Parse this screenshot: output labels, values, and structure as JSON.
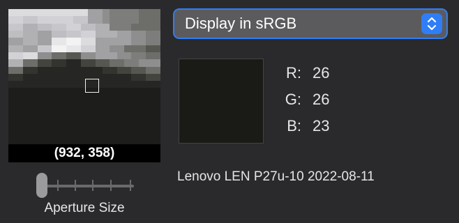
{
  "loupe": {
    "coordinates": "(932, 358)",
    "pixel_rows": [
      "ddddddddddd8876666555",
      "ccbbcccccbb8876666555",
      "bb99aabbccaa996665555",
      "aa9988aabbcc9998877666",
      "889988eeffdd888887766",
      "9988bbffeecc887755544",
      "ccdd77554477888776655",
      "995533221133445566777",
      "552211111111122334455",
      "221111111111111112233",
      "111111111111111111111",
      "000000000000000000000",
      "000000000000000000000",
      "000000000000000000000",
      "000000000000000000000",
      "000000000000000000000",
      "000000000000000000000",
      "000000000000000000000",
      "000000000000000000000"
    ]
  },
  "aperture": {
    "label": "Aperture Size",
    "level": 0
  },
  "display_mode": {
    "selected": "Display in sRGB",
    "accent": "#2f7ef6"
  },
  "color": {
    "swatch": "#1a1a17",
    "r_label": "R:",
    "r": "26",
    "g_label": "G:",
    "g": "26",
    "b_label": "B:",
    "b": "23"
  },
  "display_name": "Lenovo LEN P27u-10 2022-08-11",
  "icons": {
    "stepper": "chevron-up-down-icon"
  }
}
